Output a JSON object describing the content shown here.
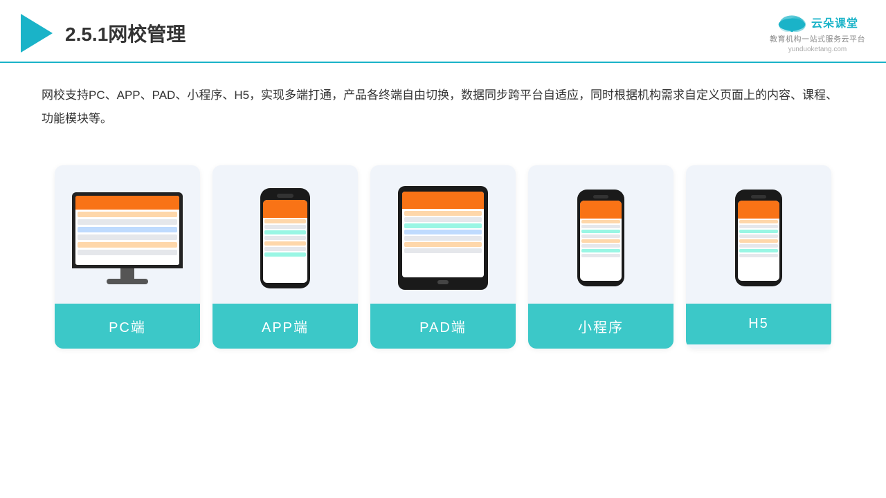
{
  "header": {
    "title": "2.5.1网校管理",
    "brand": {
      "name": "云朵课堂",
      "url": "yunduoketang.com",
      "slogan": "教育机构一站式服务云平台"
    }
  },
  "description": {
    "text": "网校支持PC、APP、PAD、小程序、H5，实现多端打通，产品各终端自由切换，数据同步跨平台自适应，同时根据机构需求自定义页面上的内容、课程、功能模块等。"
  },
  "cards": [
    {
      "label": "PC端",
      "device": "pc"
    },
    {
      "label": "APP端",
      "device": "phone"
    },
    {
      "label": "PAD端",
      "device": "tablet"
    },
    {
      "label": "小程序",
      "device": "phone-mini"
    },
    {
      "label": "H5",
      "device": "phone-mini2"
    }
  ]
}
